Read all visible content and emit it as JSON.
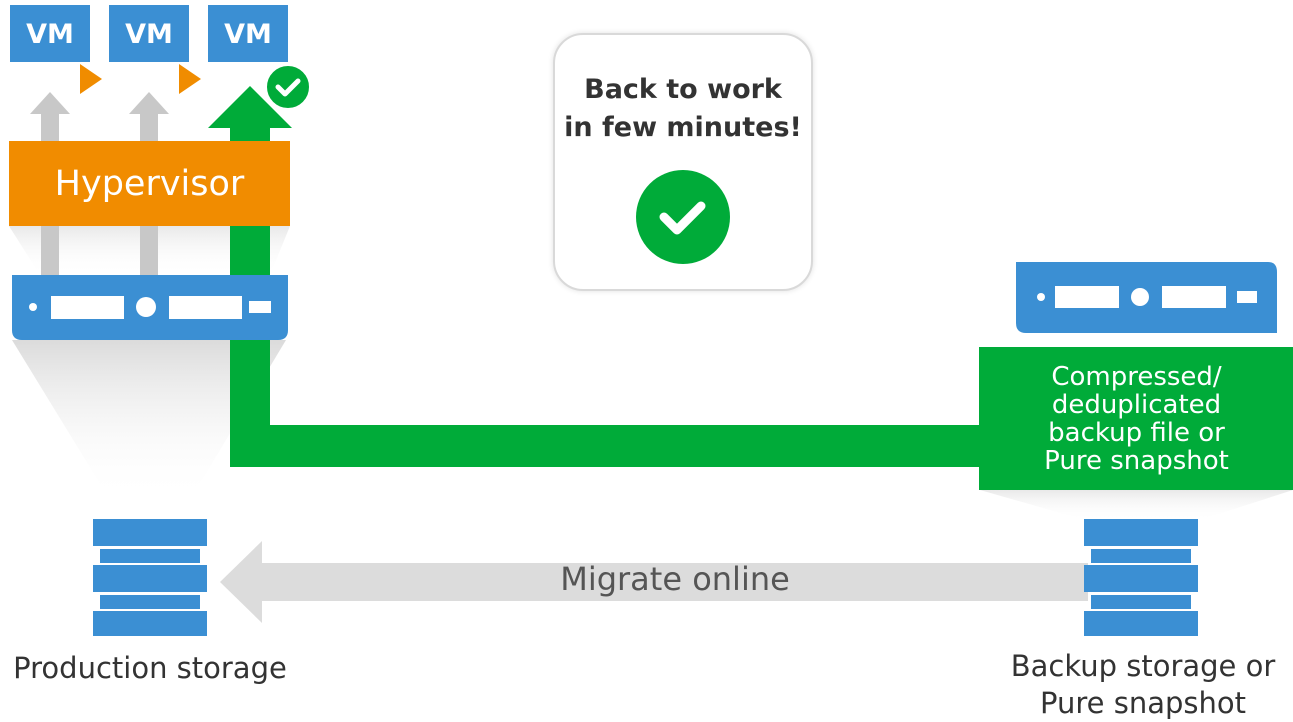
{
  "vms": [
    {
      "label": "VM",
      "state": "running"
    },
    {
      "label": "VM",
      "state": "running"
    },
    {
      "label": "VM",
      "state": "restored"
    }
  ],
  "hypervisor": {
    "label": "Hypervisor"
  },
  "callout": {
    "text": "Back to work\nin few minutes!",
    "icon": "check-circle-icon"
  },
  "backup": {
    "text": "Compressed/\ndeduplicated\nbackup file or\nPure snapshot"
  },
  "flows": {
    "migrate_label": "Migrate online"
  },
  "storage": {
    "production_label": "Production storage",
    "backup_label": "Backup storage or\nPure snapshot"
  },
  "colors": {
    "vm_blue": "#3b8fd3",
    "orange": "#f18c00",
    "green": "#00ab39",
    "gray_arrow": "#c8c8c8",
    "text": "#333333"
  }
}
